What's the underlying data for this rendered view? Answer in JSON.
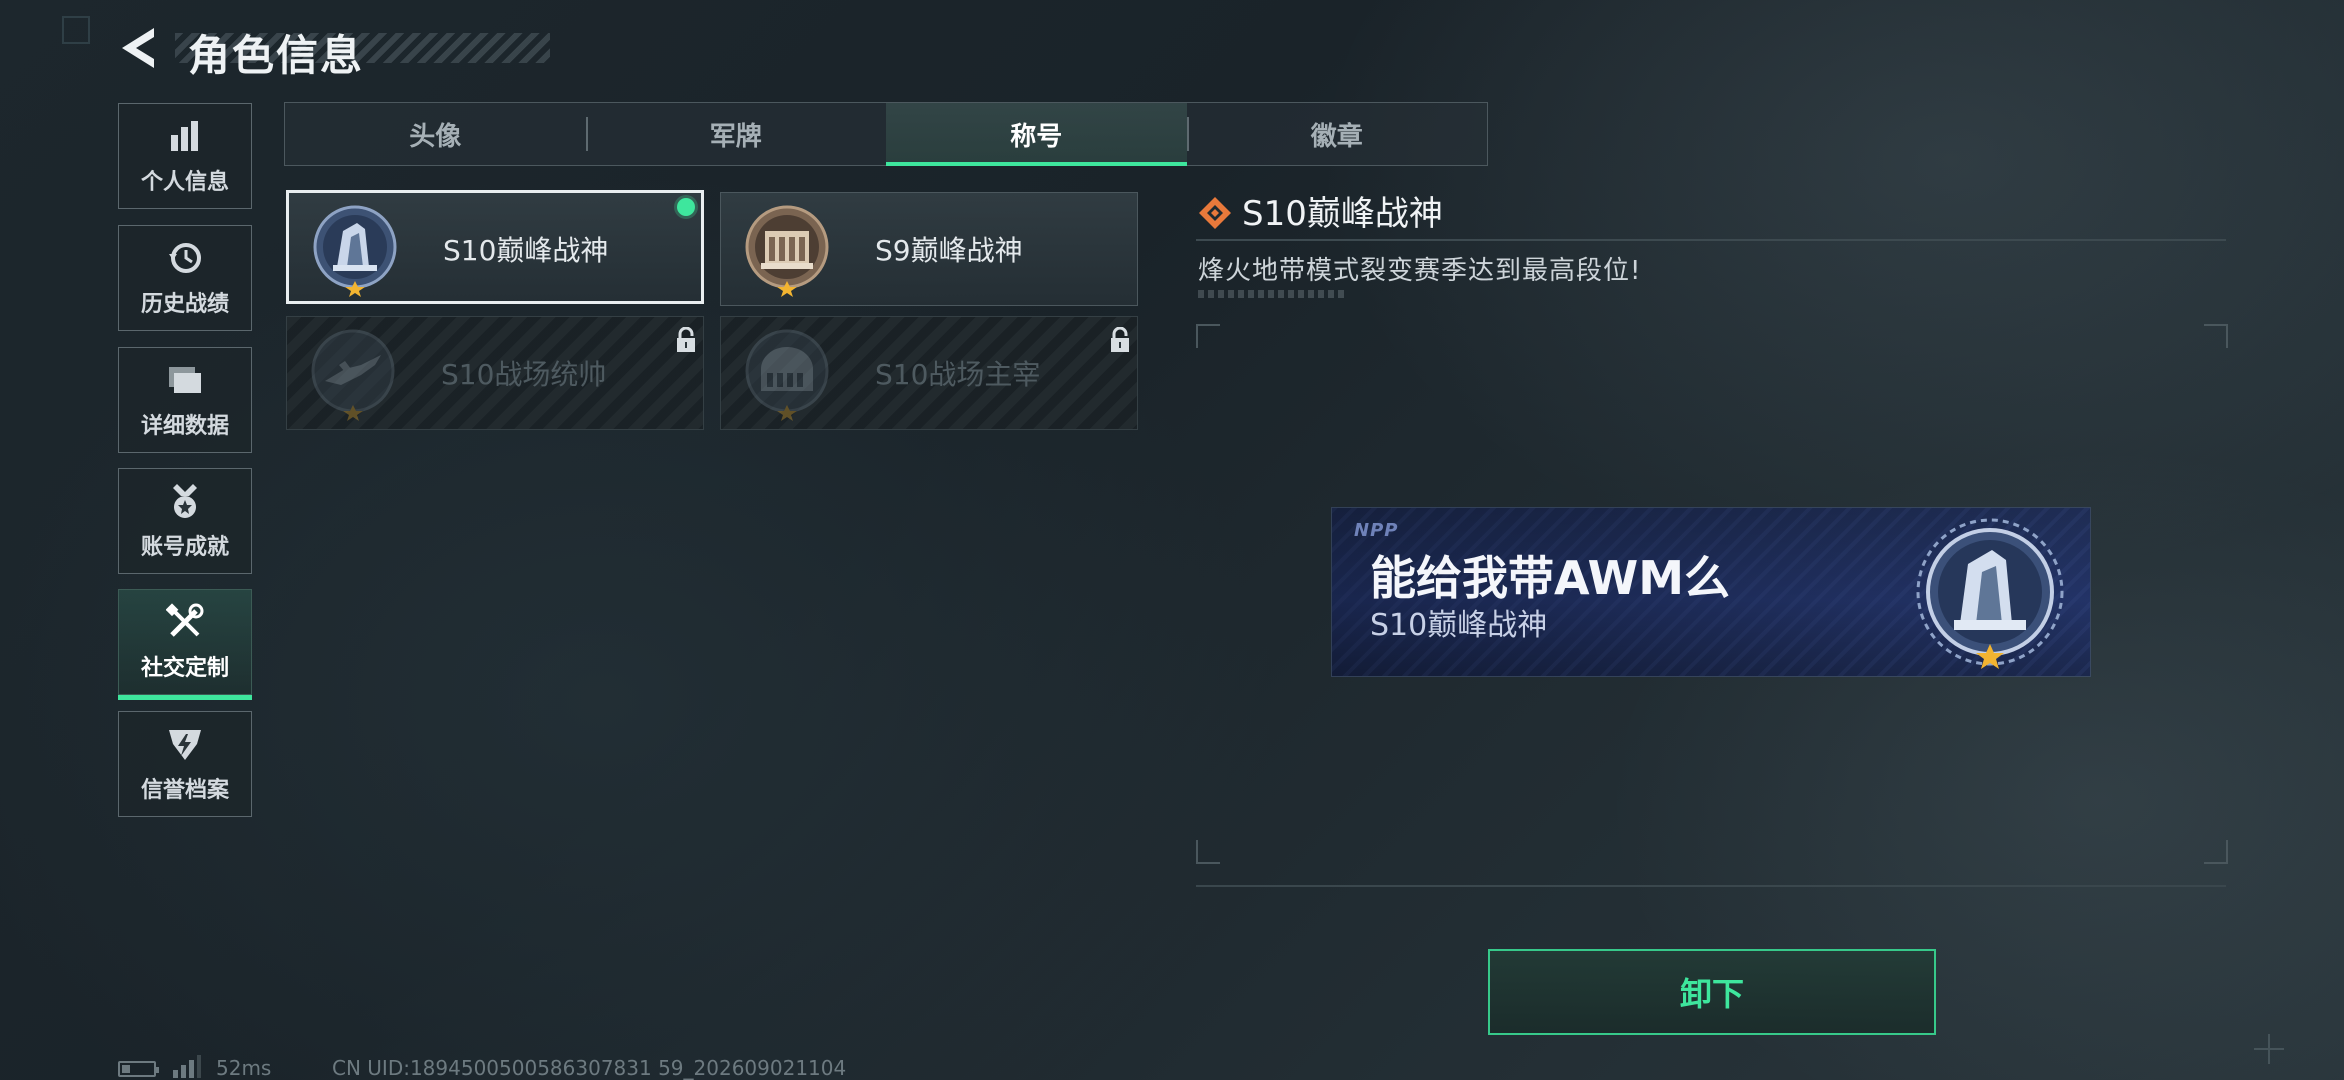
{
  "header": {
    "title": "角色信息"
  },
  "sidebar": {
    "items": [
      {
        "label": "个人信息",
        "icon": "bar-chart-icon"
      },
      {
        "label": "历史战绩",
        "icon": "history-clock-icon"
      },
      {
        "label": "详细数据",
        "icon": "folder-stack-icon"
      },
      {
        "label": "账号成就",
        "icon": "medal-icon"
      },
      {
        "label": "社交定制",
        "icon": "tools-icon",
        "active": true
      },
      {
        "label": "信誉档案",
        "icon": "shield-bolt-icon"
      }
    ]
  },
  "tabs": [
    {
      "label": "头像"
    },
    {
      "label": "军牌"
    },
    {
      "label": "称号",
      "active": true
    },
    {
      "label": "徽章"
    }
  ],
  "titles": [
    {
      "name": "S10巅峰战神",
      "state": "equipped-selected"
    },
    {
      "name": "S9巅峰战神",
      "state": "owned"
    },
    {
      "name": "S10战场统帅",
      "state": "locked"
    },
    {
      "name": "S10战场主宰",
      "state": "locked"
    }
  ],
  "detail": {
    "title": "S10巅峰战神",
    "description": "烽火地带模式裂变赛季达到最高段位!"
  },
  "nameplate": {
    "logo": "NPP",
    "player_text": "能给我带AWM么",
    "title": "S10巅峰战神"
  },
  "actions": {
    "unequip_label": "卸下"
  },
  "status_bar": {
    "ping": "52ms",
    "uid": "CN UID:1894500500586307831 59_202609021104"
  },
  "colors": {
    "accent": "#3ee69d",
    "title_icon": "#e8793b"
  }
}
